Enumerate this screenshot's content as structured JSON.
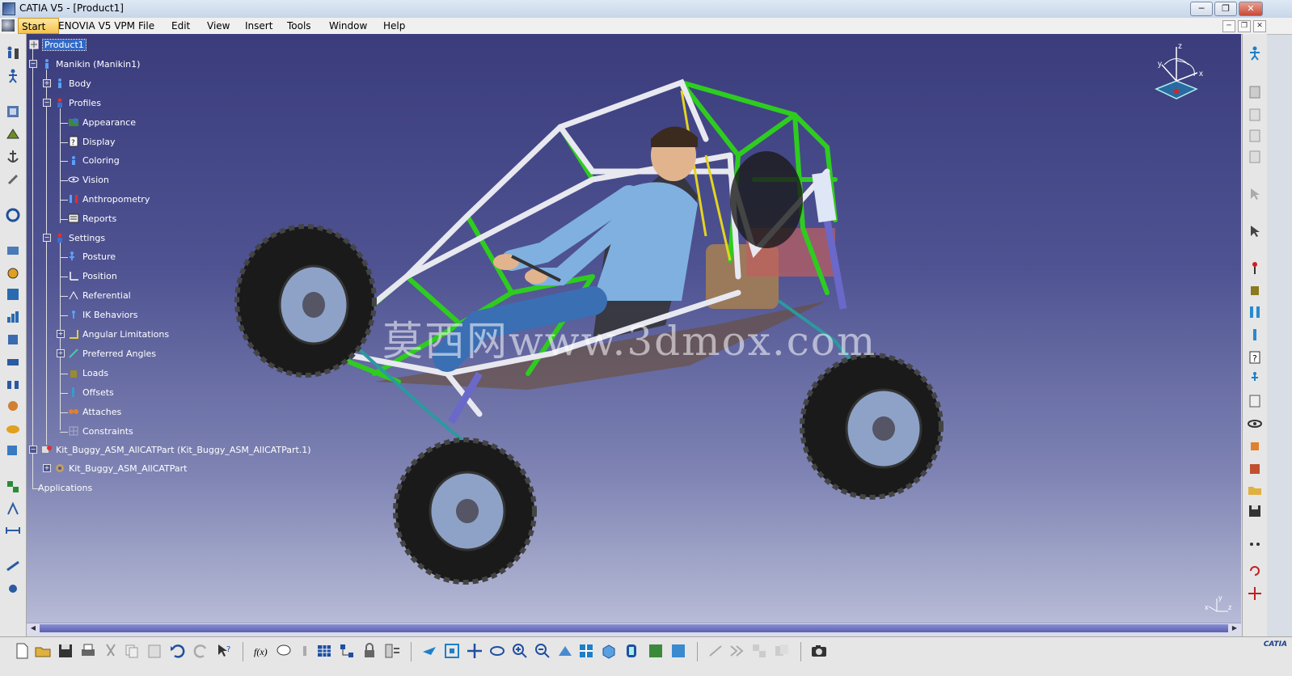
{
  "window": {
    "title": "CATIA V5 - [Product1]",
    "controls": [
      "─",
      "❐",
      "✕"
    ],
    "mdi_controls": [
      "─",
      "❐",
      "✕"
    ]
  },
  "menu": {
    "start": "Start",
    "items": [
      "ENOVIA V5 VPM",
      "File",
      "Edit",
      "View",
      "Insert",
      "Tools",
      "Window",
      "Help"
    ]
  },
  "tree": {
    "root": "Product1",
    "manikin": "Manikin (Manikin1)",
    "body": "Body",
    "profiles": "Profiles",
    "profile_items": [
      "Appearance",
      "Display",
      "Coloring",
      "Vision",
      "Anthropometry",
      "Reports"
    ],
    "settings": "Settings",
    "settings_items": [
      "Posture",
      "Position",
      "Referential",
      "IK Behaviors",
      "Angular Limitations",
      "Preferred Angles",
      "Loads",
      "Offsets",
      "Attaches",
      "Constraints"
    ],
    "part_instance": "Kit_Buggy_ASM_AllCATPart (Kit_Buggy_ASM_AllCATPart.1)",
    "part": "Kit_Buggy_ASM_AllCATPart",
    "applications": "Applications"
  },
  "watermark": "莫西网www.3dmox.com",
  "compass_labels": {
    "x": "x",
    "y": "y",
    "z": "z"
  },
  "axis_labels": {
    "x": "x",
    "y": "y",
    "z": "z"
  },
  "brand": {
    "logo": "CATIA"
  },
  "colors": {
    "bg_top": "#3a3c7c",
    "bg_bottom": "#b7bbd6",
    "frame_green": "#2ecc1f",
    "frame_white": "#e8e8f0",
    "tire": "#1a1a1a",
    "rim": "#8da2c6",
    "manikin_shirt": "#7fb0e0",
    "manikin_pants": "#3a6fb4",
    "shock": "#6a68c8",
    "selection": "#3169c6"
  }
}
